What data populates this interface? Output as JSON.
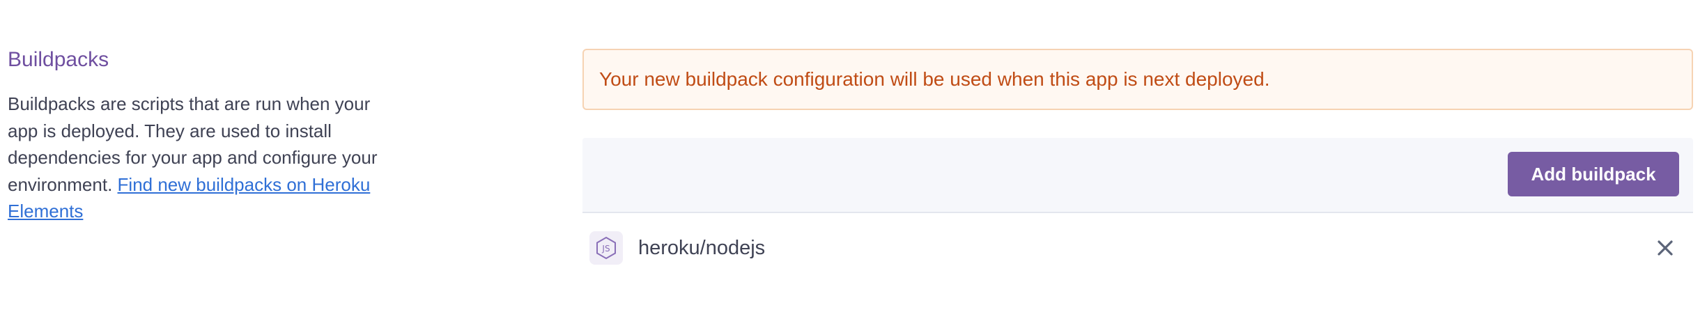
{
  "buildpacks_section": {
    "title": "Buildpacks",
    "description": "Buildpacks are scripts that are run when your app is deployed. They are used to install dependencies for your app and configure your environment. ",
    "link_text": "Find new buildpacks on Heroku Elements"
  },
  "alert": {
    "message": "Your new buildpack configuration will be used when this app is next deployed."
  },
  "toolbar": {
    "add_label": "Add buildpack"
  },
  "buildpacks": [
    {
      "name": "heroku/nodejs",
      "icon": "nodejs-icon"
    }
  ],
  "colors": {
    "accent": "#775ca3",
    "title": "#6f4fa0",
    "link": "#2f6fd6",
    "alert_text": "#c04c15",
    "alert_bg": "#fff8f2",
    "alert_border": "#f6d3b3"
  }
}
